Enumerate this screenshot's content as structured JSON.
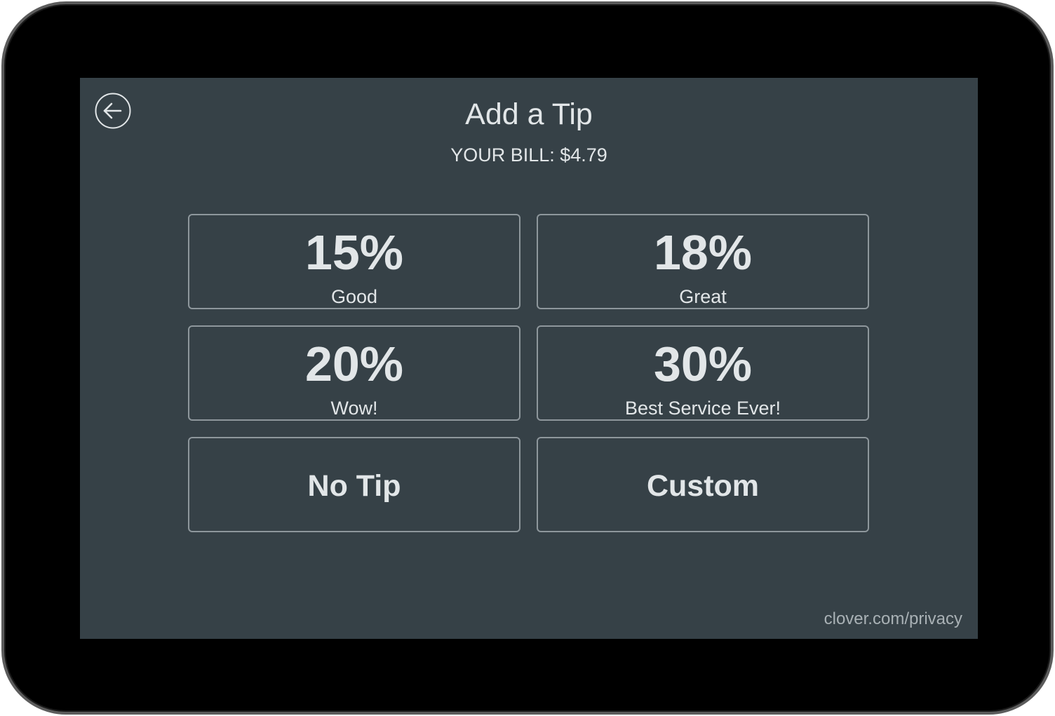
{
  "header": {
    "back_icon": "arrow-left-circle-icon",
    "title": "Add a Tip",
    "bill": "YOUR BILL: $4.79"
  },
  "tips": [
    {
      "percent": "15%",
      "label": "Good"
    },
    {
      "percent": "18%",
      "label": "Great"
    },
    {
      "percent": "20%",
      "label": "Wow!"
    },
    {
      "percent": "30%",
      "label": "Best Service Ever!"
    }
  ],
  "actions": {
    "no_tip": "No Tip",
    "custom": "Custom"
  },
  "footer": {
    "privacy_link": "clover.com/privacy"
  },
  "colors": {
    "screen_bg": "#364147",
    "button_border": "#8e979c",
    "text": "#e2e6e8",
    "muted_text": "#a9b1b5",
    "bezel": "#000000"
  }
}
